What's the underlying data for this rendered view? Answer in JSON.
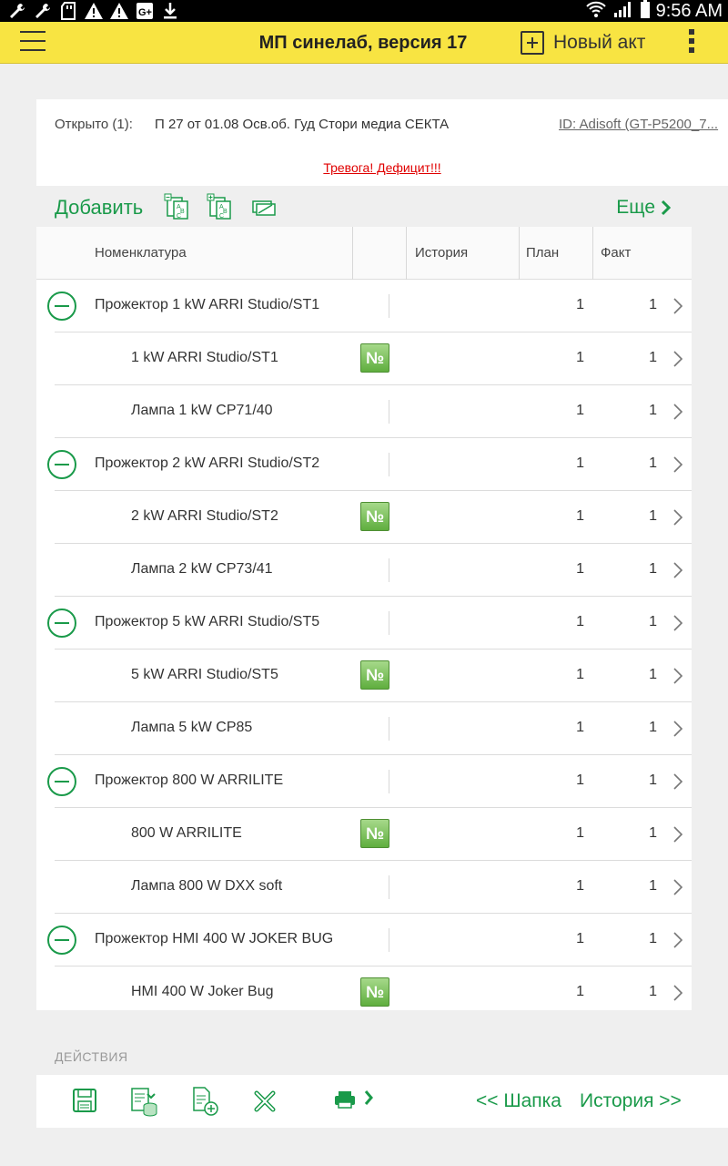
{
  "status_bar": {
    "time": "9:56 AM",
    "icons": [
      "wrench-icon",
      "wrench-icon",
      "sd-card-icon",
      "warning-icon",
      "warning-icon",
      "google-plus-icon",
      "download-icon",
      "wifi-icon",
      "signal-icon",
      "battery-icon"
    ]
  },
  "header": {
    "title": "МП синелаб, версия 17",
    "new_act_label": "Новый акт",
    "background": "#f8e442"
  },
  "info": {
    "open_label": "Открыто (1):",
    "open_document": "П 27 от 01.08 Осв.об. Гуд Стори медиа СЕКТА",
    "device_id": "ID: Adisoft (GT-P5200_7...",
    "alarm": "Тревога! Дефицит!!!"
  },
  "toolbar": {
    "add_label": "Добавить",
    "more_label": "Еще"
  },
  "table": {
    "headers": {
      "nomenclature": "Номенклатура",
      "history": "История",
      "plan": "План",
      "fact": "Факт"
    },
    "rows": [
      {
        "name": "Прожектор  1 kW ARRI Studio/ST1",
        "plan": "1",
        "fact": "1",
        "level": 0
      },
      {
        "name": "1 kW ARRI Studio/ST1",
        "plan": "1",
        "fact": "1",
        "level": 1,
        "badge": "№"
      },
      {
        "name": "Лампа 1 kW CP71/40",
        "plan": "1",
        "fact": "1",
        "level": 1
      },
      {
        "name": "Прожектор  2 kW ARRI Studio/ST2",
        "plan": "1",
        "fact": "1",
        "level": 0
      },
      {
        "name": "2 kW ARRI Studio/ST2",
        "plan": "1",
        "fact": "1",
        "level": 1,
        "badge": "№"
      },
      {
        "name": "Лампа 2 kW CP73/41",
        "plan": "1",
        "fact": "1",
        "level": 1
      },
      {
        "name": "Прожектор  5 kW ARRI Studio/ST5",
        "plan": "1",
        "fact": "1",
        "level": 0
      },
      {
        "name": "5 kW ARRI Studio/ST5",
        "plan": "1",
        "fact": "1",
        "level": 1,
        "badge": "№"
      },
      {
        "name": "Лампа 5 kW CP85",
        "plan": "1",
        "fact": "1",
        "level": 1
      },
      {
        "name": "Прожектор  800 W ARRILITE",
        "plan": "1",
        "fact": "1",
        "level": 0
      },
      {
        "name": "800 W ARRILITE",
        "plan": "1",
        "fact": "1",
        "level": 1,
        "badge": "№"
      },
      {
        "name": "Лампа 800 W DXX soft",
        "plan": "1",
        "fact": "1",
        "level": 1
      },
      {
        "name": "Прожектор HMI  400 W JOKER BUG",
        "plan": "1",
        "fact": "1",
        "level": 0
      },
      {
        "name": "HMI  400 W Joker Bug",
        "plan": "1",
        "fact": "1",
        "level": 1,
        "badge": "№"
      }
    ]
  },
  "actions": {
    "label": "ДЕЙСТВИЯ",
    "back_label": "<< Шапка",
    "history_label": "История >>"
  },
  "colors": {
    "accent": "#1a9a4a",
    "alarm": "#e00000"
  }
}
